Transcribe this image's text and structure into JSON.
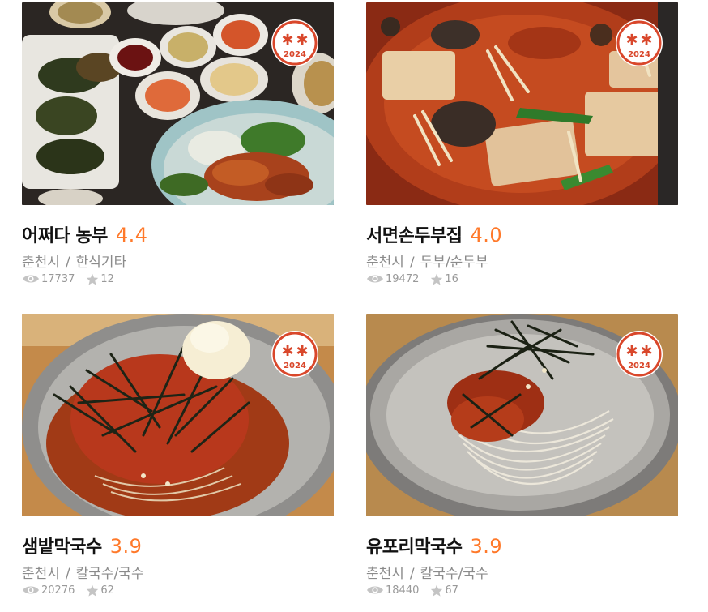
{
  "restaurants": [
    {
      "name": "어쩌다 농부",
      "score": "4.4",
      "region": "춘천시",
      "category": "한식기타",
      "views": "17737",
      "reviews": "12",
      "badge_year": "2024",
      "photo": "korean-side-dishes-plate"
    },
    {
      "name": "서면손두부집",
      "score": "4.0",
      "region": "춘천시",
      "category": "두부/순두부",
      "views": "19472",
      "reviews": "16",
      "badge_year": "2024",
      "photo": "spicy-tofu-stew"
    },
    {
      "name": "샘밭막국수",
      "score": "3.9",
      "region": "춘천시",
      "category": "칼국수/국수",
      "views": "20276",
      "reviews": "62",
      "badge_year": "2024",
      "photo": "makguksu-with-egg"
    },
    {
      "name": "유포리막국수",
      "score": "3.9",
      "region": "춘천시",
      "category": "칼국수/국수",
      "views": "18440",
      "reviews": "67",
      "badge_year": "2024",
      "photo": "makguksu-with-seaweed"
    }
  ],
  "separator": "/",
  "colors": {
    "score": "#ff792a",
    "badge": "#d9472b",
    "meta": "#8b8b8b"
  },
  "icons": {
    "views": "eye-icon",
    "reviews": "star-icon"
  }
}
